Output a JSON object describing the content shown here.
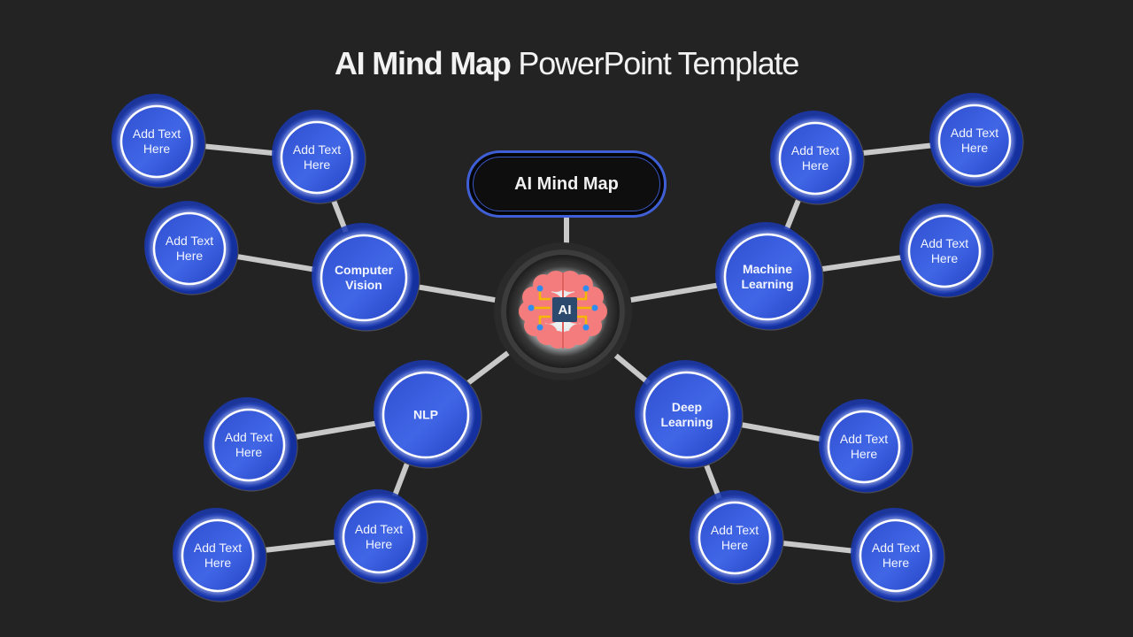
{
  "slide": {
    "title_bold": "AI Mind Map",
    "title_light": "PowerPoint Template"
  },
  "center": {
    "label": "AI Mind Map",
    "hub_icon": "brain-chip-icon",
    "hub_badge": "AI"
  },
  "colors": {
    "background": "#232323",
    "node_fill": "#3b5ee0",
    "node_shadow": "#14309e",
    "node_ring": "#ffffff",
    "connector": "#c8c8c8",
    "pill_border": "#3f5fd6",
    "brain": "#f47c7c",
    "circuit": "#f5b800",
    "circuit_dot": "#2f8cf0"
  },
  "branches": [
    {
      "id": "computer-vision",
      "label": "Computer\nVision",
      "leaves": [
        {
          "label": "Add Text\nHere"
        },
        {
          "label": "Add Text\nHere"
        },
        {
          "label": "Add Text\nHere"
        }
      ]
    },
    {
      "id": "machine-learning",
      "label": "Machine\nLearning",
      "leaves": [
        {
          "label": "Add Text\nHere"
        },
        {
          "label": "Add Text\nHere"
        },
        {
          "label": "Add Text\nHere"
        }
      ]
    },
    {
      "id": "nlp",
      "label": "NLP",
      "leaves": [
        {
          "label": "Add Text\nHere"
        },
        {
          "label": "Add Text\nHere"
        },
        {
          "label": "Add Text\nHere"
        }
      ]
    },
    {
      "id": "deep-learning",
      "label": "Deep\nLearning",
      "leaves": [
        {
          "label": "Add Text\nHere"
        },
        {
          "label": "Add Text\nHere"
        },
        {
          "label": "Add Text\nHere"
        }
      ]
    }
  ]
}
